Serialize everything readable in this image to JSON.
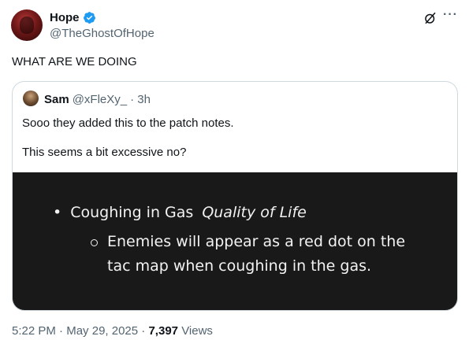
{
  "author": {
    "name": "Hope",
    "handle": "@TheGhostOfHope"
  },
  "tweet": {
    "text": "WHAT ARE WE DOING"
  },
  "quoted": {
    "name": "Sam",
    "handle": "@xFleXy_",
    "time": "· 3h",
    "line1": "Sooo they added this to the patch notes.",
    "line2": "This seems a bit excessive no?",
    "image": {
      "bullet_title": "Coughing in Gas",
      "bullet_tag": "Quality of Life",
      "sub_bullet": "Enemies will appear as a red dot on the tac map when coughing in the gas."
    }
  },
  "meta": {
    "time": "5:22 PM",
    "sep": "·",
    "date": "May 29, 2025",
    "views_count": "7,397",
    "views_label": "Views"
  },
  "colors": {
    "verified": "#1d9bf0",
    "secondary_text": "#536471",
    "image_bg": "#191919"
  }
}
